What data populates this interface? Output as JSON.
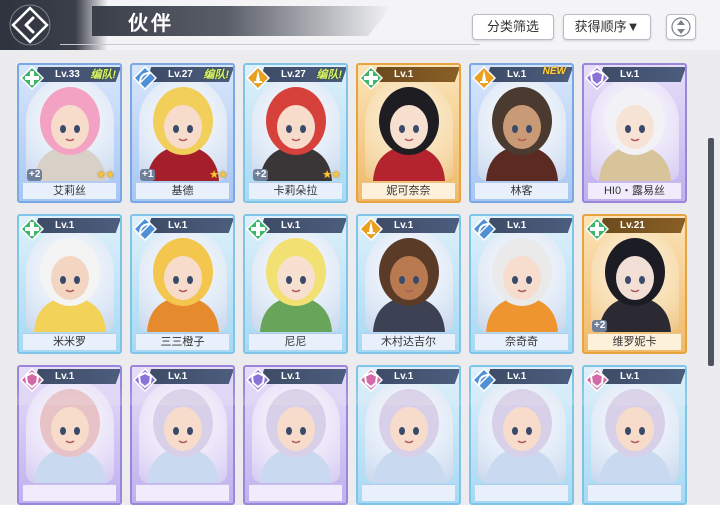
{
  "header": {
    "title": "伙伴",
    "back_icon": "back-diamond-icon",
    "filter_label": "分类筛选",
    "sort_label": "获得顺序▼",
    "order_icon": "sort-updown-icon"
  },
  "cards": [
    {
      "level": "Lv.33",
      "team": "编队!",
      "new": "",
      "name": "艾莉丝",
      "plus": "+2",
      "stars": "★★",
      "role_icon": "heal-cross-icon",
      "frame": "blue",
      "role_color": "#3fb56a",
      "hair": "#f4a2c4",
      "skin": "#f7dccb",
      "outfit": "#d9d0c8"
    },
    {
      "level": "Lv.27",
      "team": "编队!",
      "new": "",
      "name": "基德",
      "plus": "+1",
      "stars": "★★",
      "role_icon": "bow-icon",
      "frame": "blue",
      "role_color": "#4f8fd6",
      "hair": "#f1cf5a",
      "skin": "#f7dccb",
      "outfit": "#a51f2a"
    },
    {
      "level": "Lv.27",
      "team": "编队!",
      "new": "",
      "name": "卡莉朵拉",
      "plus": "+2",
      "stars": "★★",
      "role_icon": "sword-icon",
      "frame": "cyan",
      "role_color": "#e7a020",
      "hair": "#d6413b",
      "skin": "#f7dccb",
      "outfit": "#3a3536"
    },
    {
      "level": "Lv.1",
      "team": "",
      "new": "",
      "name": "妮可奈奈",
      "plus": "",
      "stars": "",
      "role_icon": "heal-cross-icon",
      "frame": "orange",
      "role_color": "#3fb56a",
      "hair": "#1d1d22",
      "skin": "#f7e0cf",
      "outfit": "#b3242e"
    },
    {
      "level": "Lv.1",
      "team": "",
      "new": "NEW",
      "name": "林客",
      "plus": "",
      "stars": "",
      "role_icon": "sword-icon",
      "frame": "blue",
      "role_color": "#e7a020",
      "hair": "#4a3a30",
      "skin": "#c99a76",
      "outfit": "#5b2a22"
    },
    {
      "level": "Lv.1",
      "team": "",
      "new": "",
      "name": "HI0・露易丝",
      "plus": "",
      "stars": "",
      "role_icon": "shield-icon",
      "frame": "purple",
      "role_color": "#8a73d6",
      "hair": "#f2f2f6",
      "skin": "#f7e3d6",
      "outfit": "#d7c49a"
    },
    {
      "level": "Lv.1",
      "team": "",
      "new": "",
      "name": "米米罗",
      "plus": "",
      "stars": "",
      "role_icon": "heal-cross-icon",
      "frame": "cyan",
      "role_color": "#3fb56a",
      "hair": "#f4f4f4",
      "skin": "#f3d6c2",
      "outfit": "#f2d258"
    },
    {
      "level": "Lv.1",
      "team": "",
      "new": "",
      "name": "三三橙子",
      "plus": "",
      "stars": "",
      "role_icon": "bow-icon",
      "frame": "cyan",
      "role_color": "#4f8fd6",
      "hair": "#f3c64d",
      "skin": "#f7dccb",
      "outfit": "#e68a2e"
    },
    {
      "level": "Lv.1",
      "team": "",
      "new": "",
      "name": "尼尼",
      "plus": "",
      "stars": "",
      "role_icon": "heal-cross-icon",
      "frame": "cyan",
      "role_color": "#3fb56a",
      "hair": "#f2e073",
      "skin": "#f7e0cf",
      "outfit": "#68a45a"
    },
    {
      "level": "Lv.1",
      "team": "",
      "new": "",
      "name": "木村达吉尔",
      "plus": "",
      "stars": "",
      "role_icon": "sword-icon",
      "frame": "cyan",
      "role_color": "#e7a020",
      "hair": "#5a3b28",
      "skin": "#b97a52",
      "outfit": "#3c4254"
    },
    {
      "level": "Lv.1",
      "team": "",
      "new": "",
      "name": "奈奇奇",
      "plus": "",
      "stars": "",
      "role_icon": "bow-icon",
      "frame": "cyan",
      "role_color": "#4f8fd6",
      "hair": "#eaeaea",
      "skin": "#f6ddcd",
      "outfit": "#ef9530"
    },
    {
      "level": "Lv.21",
      "team": "",
      "new": "",
      "name": "维罗妮卡",
      "plus": "+2",
      "stars": "",
      "role_icon": "heal-cross-icon",
      "frame": "orange",
      "role_color": "#3fb56a",
      "hair": "#1c1c24",
      "skin": "#f2dfd6",
      "outfit": "#2b2a33"
    },
    {
      "level": "Lv.1",
      "team": "",
      "new": "",
      "name": "",
      "plus": "",
      "stars": "",
      "role_icon": "shield-icon",
      "frame": "purple",
      "role_color": "#d36aa8",
      "hair": "#e7c2c7",
      "skin": "#f7dccb",
      "outfit": "#c9d9ef"
    },
    {
      "level": "Lv.1",
      "team": "",
      "new": "",
      "name": "",
      "plus": "",
      "stars": "",
      "role_icon": "shield-icon",
      "frame": "purple",
      "role_color": "#8a73d6",
      "hair": "#d8d0e8",
      "skin": "#f7dccb",
      "outfit": "#c9d9ef"
    },
    {
      "level": "Lv.1",
      "team": "",
      "new": "",
      "name": "",
      "plus": "",
      "stars": "",
      "role_icon": "shield-icon",
      "frame": "purple",
      "role_color": "#8a73d6",
      "hair": "#d8d0e8",
      "skin": "#f7dccb",
      "outfit": "#c9d9ef"
    },
    {
      "level": "Lv.1",
      "team": "",
      "new": "",
      "name": "",
      "plus": "",
      "stars": "",
      "role_icon": "shield-icon",
      "frame": "cyan",
      "role_color": "#d36aa8",
      "hair": "#d8d0e8",
      "skin": "#f7dccb",
      "outfit": "#c9d9ef"
    },
    {
      "level": "Lv.1",
      "team": "",
      "new": "",
      "name": "",
      "plus": "",
      "stars": "",
      "role_icon": "bow-icon",
      "frame": "cyan",
      "role_color": "#4f8fd6",
      "hair": "#d8d0e8",
      "skin": "#f7dccb",
      "outfit": "#c9d9ef"
    },
    {
      "level": "Lv.1",
      "team": "",
      "new": "",
      "name": "",
      "plus": "",
      "stars": "",
      "role_icon": "shield-icon",
      "frame": "cyan",
      "role_color": "#d36aa8",
      "hair": "#d8d0e8",
      "skin": "#f7dccb",
      "outfit": "#c9d9ef"
    }
  ]
}
